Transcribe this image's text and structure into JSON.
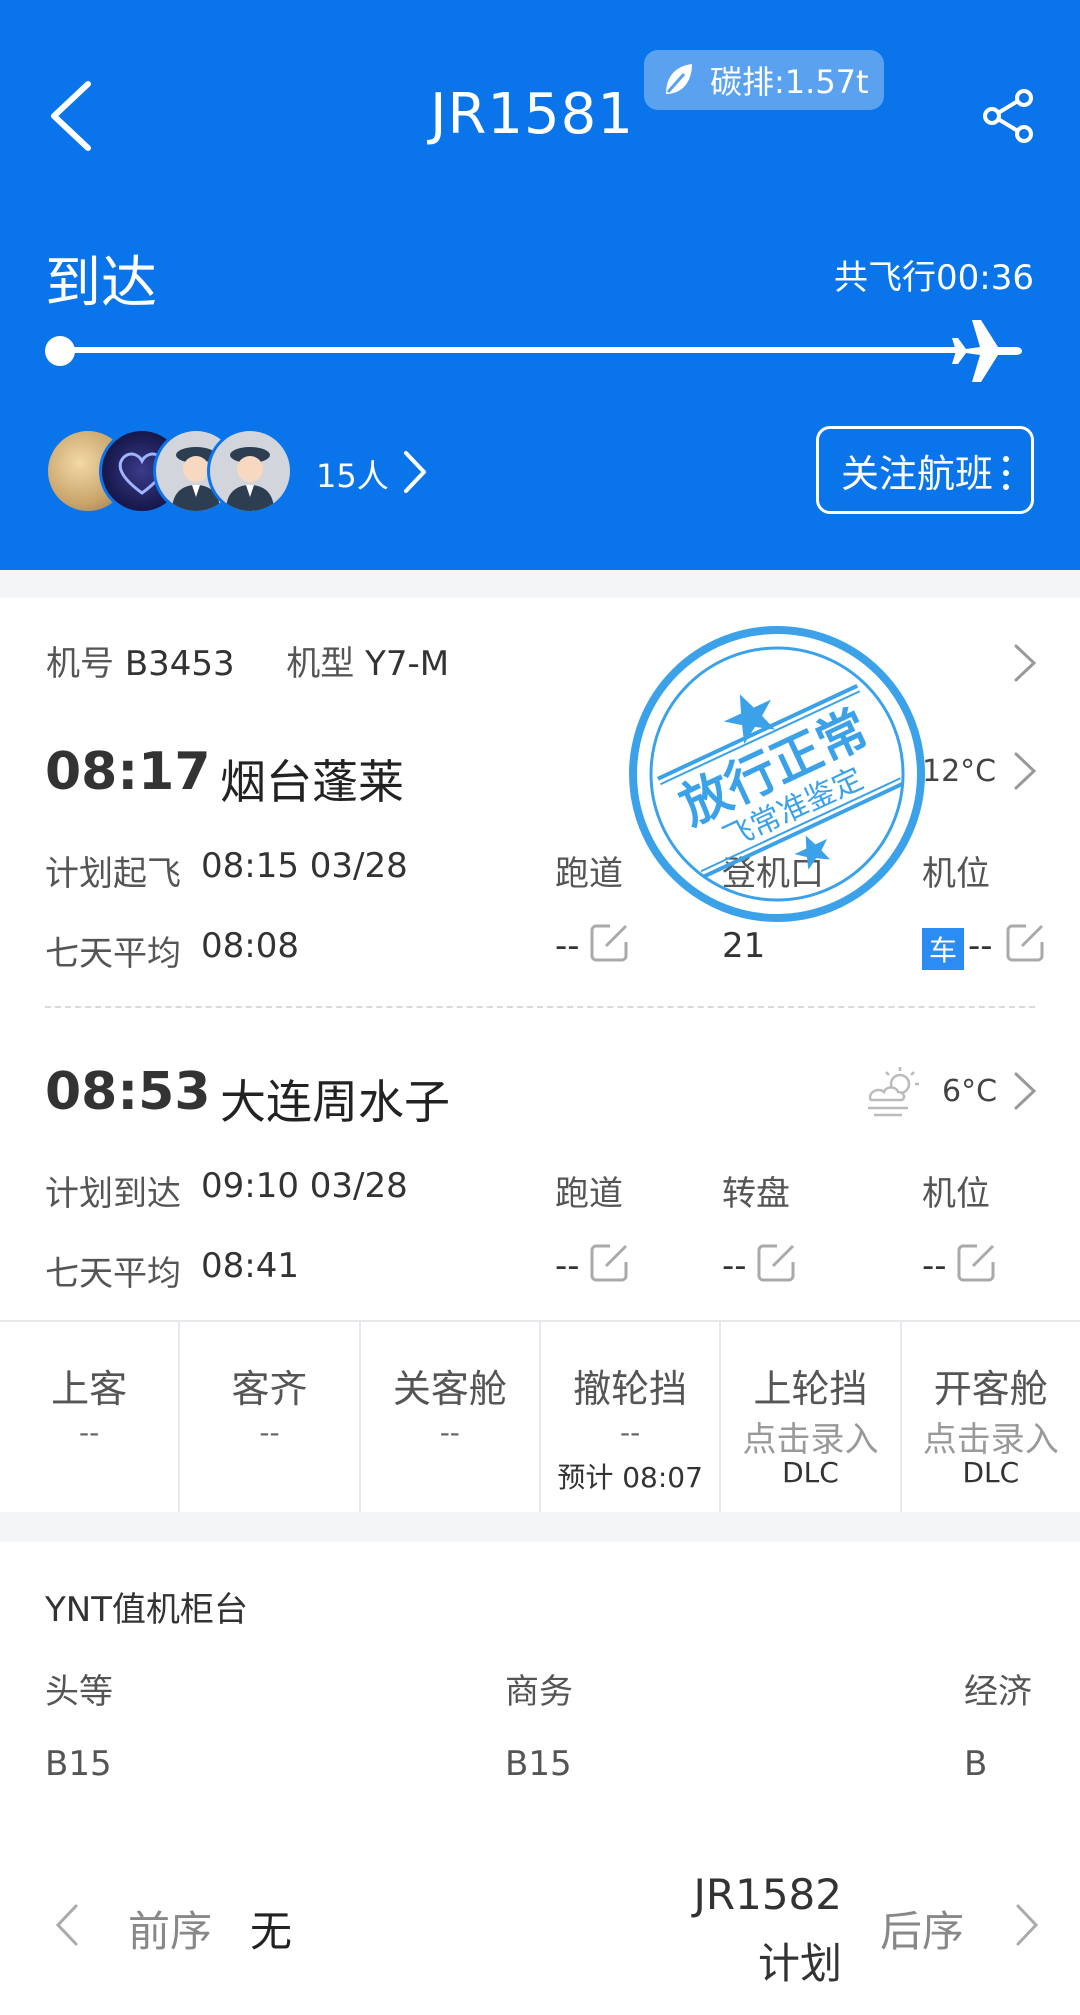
{
  "header": {
    "flight_no": "JR1581",
    "carbon": "碳排:1.57t",
    "status": "到达",
    "duration": "共飞行00:36",
    "people_count": "15人",
    "follow_label": "关注航班"
  },
  "aircraft": {
    "reg_label": "机号",
    "reg": "B3453",
    "type_label": "机型",
    "type": "Y7-M"
  },
  "departure": {
    "time": "08:17",
    "city": "烟台蓬莱",
    "temp": "12°C",
    "plan_label": "计划起飞",
    "plan_value": "08:15 03/28",
    "avg_label": "七天平均",
    "avg_value": "08:08",
    "runway_label": "跑道",
    "runway_value": "--",
    "gate_label": "登机口",
    "gate_value": "21",
    "stand_label": "机位",
    "stand_badge": "车",
    "stand_value": "--"
  },
  "arrival": {
    "time": "08:53",
    "city": "大连周水子",
    "temp": "6°C",
    "plan_label": "计划到达",
    "plan_value": "09:10 03/28",
    "avg_label": "七天平均",
    "avg_value": "08:41",
    "runway_label": "跑道",
    "runway_value": "--",
    "carousel_label": "转盘",
    "carousel_value": "--",
    "stand_label": "机位",
    "stand_value": "--"
  },
  "stamp": {
    "line1": "放行正常",
    "line2": "飞常准鉴定"
  },
  "milestones": [
    {
      "label": "上客",
      "value": "--",
      "sub": ""
    },
    {
      "label": "客齐",
      "value": "--",
      "sub": ""
    },
    {
      "label": "关客舱",
      "value": "--",
      "sub": ""
    },
    {
      "label": "撤轮挡",
      "value": "--",
      "sub": "预计 08:07"
    },
    {
      "label": "上轮挡",
      "value": "点击录入",
      "sub": "DLC"
    },
    {
      "label": "开客舱",
      "value": "点击录入",
      "sub": "DLC"
    }
  ],
  "counter": {
    "title": "YNT值机柜台",
    "first_label": "头等",
    "first_value": "B15",
    "business_label": "商务",
    "business_value": "B15",
    "economy_label": "经济",
    "economy_value": "B"
  },
  "nav": {
    "prev_label": "前序",
    "prev_value": "无",
    "next_flight": "JR1582",
    "next_status": "计划",
    "next_label": "后序"
  }
}
